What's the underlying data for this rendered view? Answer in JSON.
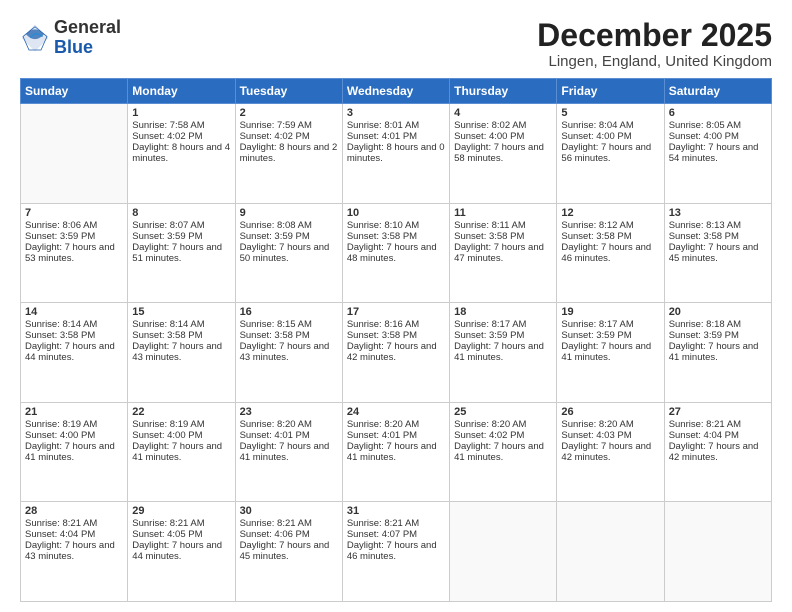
{
  "header": {
    "logo_line1": "General",
    "logo_line2": "Blue",
    "month_title": "December 2025",
    "location": "Lingen, England, United Kingdom"
  },
  "days_of_week": [
    "Sunday",
    "Monday",
    "Tuesday",
    "Wednesday",
    "Thursday",
    "Friday",
    "Saturday"
  ],
  "weeks": [
    [
      {
        "day": "",
        "sunrise": "",
        "sunset": "",
        "daylight": ""
      },
      {
        "day": "1",
        "sunrise": "Sunrise: 7:58 AM",
        "sunset": "Sunset: 4:02 PM",
        "daylight": "Daylight: 8 hours and 4 minutes."
      },
      {
        "day": "2",
        "sunrise": "Sunrise: 7:59 AM",
        "sunset": "Sunset: 4:02 PM",
        "daylight": "Daylight: 8 hours and 2 minutes."
      },
      {
        "day": "3",
        "sunrise": "Sunrise: 8:01 AM",
        "sunset": "Sunset: 4:01 PM",
        "daylight": "Daylight: 8 hours and 0 minutes."
      },
      {
        "day": "4",
        "sunrise": "Sunrise: 8:02 AM",
        "sunset": "Sunset: 4:00 PM",
        "daylight": "Daylight: 7 hours and 58 minutes."
      },
      {
        "day": "5",
        "sunrise": "Sunrise: 8:04 AM",
        "sunset": "Sunset: 4:00 PM",
        "daylight": "Daylight: 7 hours and 56 minutes."
      },
      {
        "day": "6",
        "sunrise": "Sunrise: 8:05 AM",
        "sunset": "Sunset: 4:00 PM",
        "daylight": "Daylight: 7 hours and 54 minutes."
      }
    ],
    [
      {
        "day": "7",
        "sunrise": "Sunrise: 8:06 AM",
        "sunset": "Sunset: 3:59 PM",
        "daylight": "Daylight: 7 hours and 53 minutes."
      },
      {
        "day": "8",
        "sunrise": "Sunrise: 8:07 AM",
        "sunset": "Sunset: 3:59 PM",
        "daylight": "Daylight: 7 hours and 51 minutes."
      },
      {
        "day": "9",
        "sunrise": "Sunrise: 8:08 AM",
        "sunset": "Sunset: 3:59 PM",
        "daylight": "Daylight: 7 hours and 50 minutes."
      },
      {
        "day": "10",
        "sunrise": "Sunrise: 8:10 AM",
        "sunset": "Sunset: 3:58 PM",
        "daylight": "Daylight: 7 hours and 48 minutes."
      },
      {
        "day": "11",
        "sunrise": "Sunrise: 8:11 AM",
        "sunset": "Sunset: 3:58 PM",
        "daylight": "Daylight: 7 hours and 47 minutes."
      },
      {
        "day": "12",
        "sunrise": "Sunrise: 8:12 AM",
        "sunset": "Sunset: 3:58 PM",
        "daylight": "Daylight: 7 hours and 46 minutes."
      },
      {
        "day": "13",
        "sunrise": "Sunrise: 8:13 AM",
        "sunset": "Sunset: 3:58 PM",
        "daylight": "Daylight: 7 hours and 45 minutes."
      }
    ],
    [
      {
        "day": "14",
        "sunrise": "Sunrise: 8:14 AM",
        "sunset": "Sunset: 3:58 PM",
        "daylight": "Daylight: 7 hours and 44 minutes."
      },
      {
        "day": "15",
        "sunrise": "Sunrise: 8:14 AM",
        "sunset": "Sunset: 3:58 PM",
        "daylight": "Daylight: 7 hours and 43 minutes."
      },
      {
        "day": "16",
        "sunrise": "Sunrise: 8:15 AM",
        "sunset": "Sunset: 3:58 PM",
        "daylight": "Daylight: 7 hours and 43 minutes."
      },
      {
        "day": "17",
        "sunrise": "Sunrise: 8:16 AM",
        "sunset": "Sunset: 3:58 PM",
        "daylight": "Daylight: 7 hours and 42 minutes."
      },
      {
        "day": "18",
        "sunrise": "Sunrise: 8:17 AM",
        "sunset": "Sunset: 3:59 PM",
        "daylight": "Daylight: 7 hours and 41 minutes."
      },
      {
        "day": "19",
        "sunrise": "Sunrise: 8:17 AM",
        "sunset": "Sunset: 3:59 PM",
        "daylight": "Daylight: 7 hours and 41 minutes."
      },
      {
        "day": "20",
        "sunrise": "Sunrise: 8:18 AM",
        "sunset": "Sunset: 3:59 PM",
        "daylight": "Daylight: 7 hours and 41 minutes."
      }
    ],
    [
      {
        "day": "21",
        "sunrise": "Sunrise: 8:19 AM",
        "sunset": "Sunset: 4:00 PM",
        "daylight": "Daylight: 7 hours and 41 minutes."
      },
      {
        "day": "22",
        "sunrise": "Sunrise: 8:19 AM",
        "sunset": "Sunset: 4:00 PM",
        "daylight": "Daylight: 7 hours and 41 minutes."
      },
      {
        "day": "23",
        "sunrise": "Sunrise: 8:20 AM",
        "sunset": "Sunset: 4:01 PM",
        "daylight": "Daylight: 7 hours and 41 minutes."
      },
      {
        "day": "24",
        "sunrise": "Sunrise: 8:20 AM",
        "sunset": "Sunset: 4:01 PM",
        "daylight": "Daylight: 7 hours and 41 minutes."
      },
      {
        "day": "25",
        "sunrise": "Sunrise: 8:20 AM",
        "sunset": "Sunset: 4:02 PM",
        "daylight": "Daylight: 7 hours and 41 minutes."
      },
      {
        "day": "26",
        "sunrise": "Sunrise: 8:20 AM",
        "sunset": "Sunset: 4:03 PM",
        "daylight": "Daylight: 7 hours and 42 minutes."
      },
      {
        "day": "27",
        "sunrise": "Sunrise: 8:21 AM",
        "sunset": "Sunset: 4:04 PM",
        "daylight": "Daylight: 7 hours and 42 minutes."
      }
    ],
    [
      {
        "day": "28",
        "sunrise": "Sunrise: 8:21 AM",
        "sunset": "Sunset: 4:04 PM",
        "daylight": "Daylight: 7 hours and 43 minutes."
      },
      {
        "day": "29",
        "sunrise": "Sunrise: 8:21 AM",
        "sunset": "Sunset: 4:05 PM",
        "daylight": "Daylight: 7 hours and 44 minutes."
      },
      {
        "day": "30",
        "sunrise": "Sunrise: 8:21 AM",
        "sunset": "Sunset: 4:06 PM",
        "daylight": "Daylight: 7 hours and 45 minutes."
      },
      {
        "day": "31",
        "sunrise": "Sunrise: 8:21 AM",
        "sunset": "Sunset: 4:07 PM",
        "daylight": "Daylight: 7 hours and 46 minutes."
      },
      {
        "day": "",
        "sunrise": "",
        "sunset": "",
        "daylight": ""
      },
      {
        "day": "",
        "sunrise": "",
        "sunset": "",
        "daylight": ""
      },
      {
        "day": "",
        "sunrise": "",
        "sunset": "",
        "daylight": ""
      }
    ]
  ]
}
